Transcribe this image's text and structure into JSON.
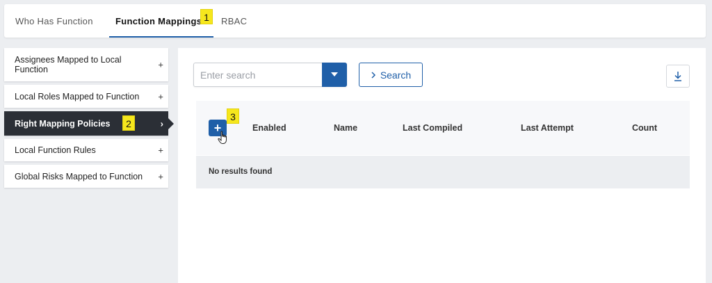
{
  "tabs": [
    {
      "label": "Who Has Function"
    },
    {
      "label": "Function Mappings"
    },
    {
      "label": "RBAC"
    }
  ],
  "callouts": [
    "1",
    "2",
    "3"
  ],
  "sidebar": {
    "items": [
      {
        "label": "Assignees Mapped to Local Function",
        "marker": "+"
      },
      {
        "label": "Local Roles Mapped to Function",
        "marker": "+"
      },
      {
        "label": "Right Mapping Policies",
        "marker": "›"
      },
      {
        "label": "Local Function Rules",
        "marker": "+"
      },
      {
        "label": "Global Risks Mapped to Function",
        "marker": "+"
      }
    ]
  },
  "search": {
    "placeholder": "Enter search",
    "button_label": "Search"
  },
  "table": {
    "columns": [
      "Enabled",
      "Name",
      "Last Compiled",
      "Last Attempt",
      "Count"
    ],
    "add_label": "+",
    "empty_text": "No results found"
  },
  "colors": {
    "accent": "#1f5fa8",
    "sidebar_active": "#2b2f36",
    "callout": "#f6e71d"
  },
  "icons": [
    "caret-down-icon",
    "chevron-right-icon",
    "download-icon",
    "plus-icon",
    "hand-pointer-icon"
  ]
}
